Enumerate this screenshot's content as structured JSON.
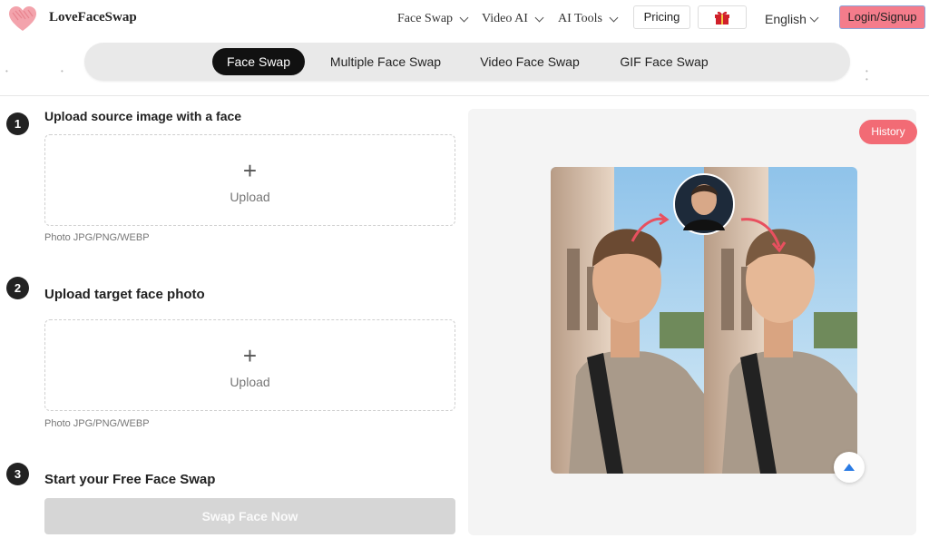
{
  "header": {
    "brand": "LoveFaceSwap",
    "nav": [
      {
        "label": "Face Swap"
      },
      {
        "label": "Video AI"
      },
      {
        "label": "AI Tools"
      }
    ],
    "pricing_label": "Pricing",
    "language": "English",
    "login_label": "Login/Signup"
  },
  "tabs": [
    {
      "label": "Face Swap",
      "active": true
    },
    {
      "label": "Multiple Face Swap",
      "active": false
    },
    {
      "label": "Video Face Swap",
      "active": false
    },
    {
      "label": "GIF Face Swap",
      "active": false
    }
  ],
  "steps": {
    "step1": {
      "number": "1",
      "title": "Upload source image with a face",
      "upload_label": "Upload",
      "hint": "Photo JPG/PNG/WEBP"
    },
    "step2": {
      "number": "2",
      "title": "Upload target face photo",
      "upload_label": "Upload",
      "hint": "Photo JPG/PNG/WEBP"
    },
    "step3": {
      "number": "3",
      "title": "Start your Free Face Swap",
      "button_label": "Swap Face Now"
    }
  },
  "preview": {
    "history_label": "History"
  },
  "colors": {
    "brand_pink": "#f47c8b",
    "history_red": "#f26b75",
    "active_tab": "#111111",
    "disabled_button": "#d6d6d6"
  }
}
